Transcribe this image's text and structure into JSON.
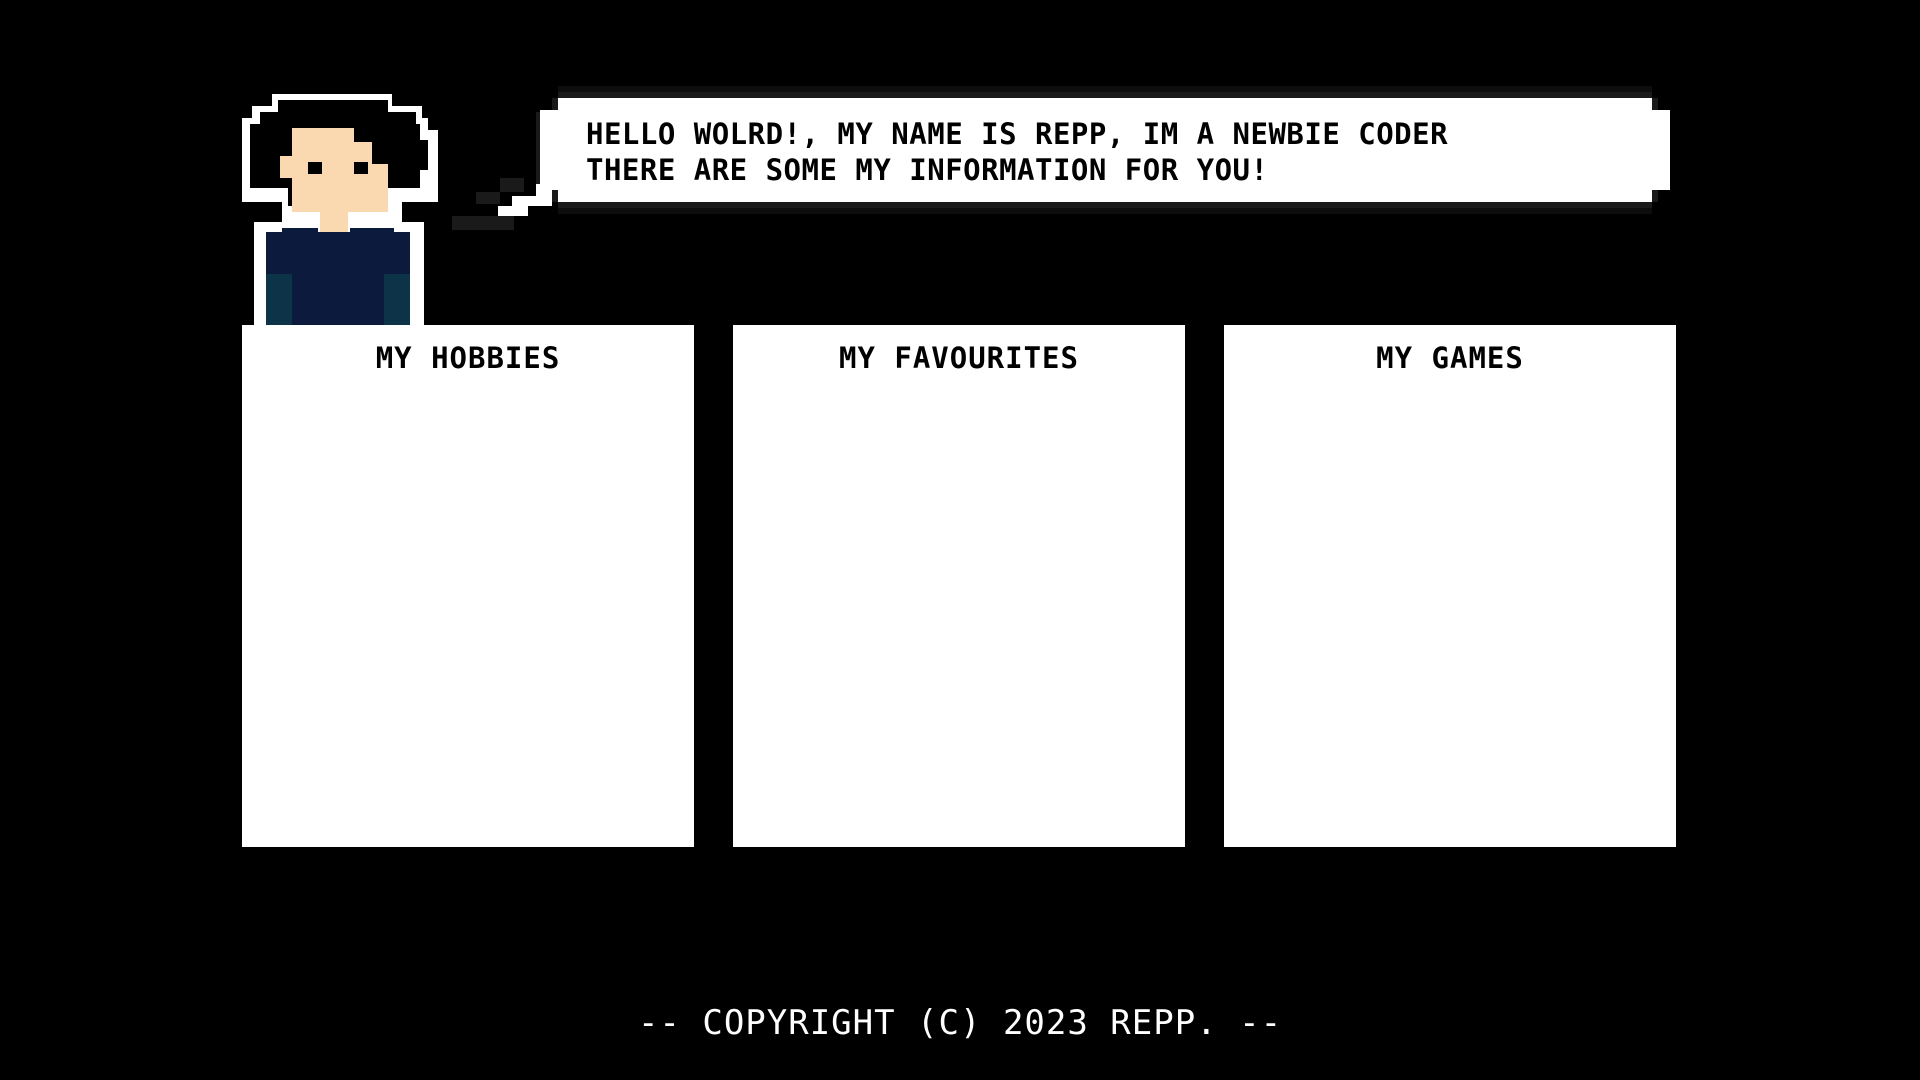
{
  "speech": {
    "line1": "HELLO WOLRD!, MY NAME IS REPP, IM A NEWBIE CODER",
    "line2": "THERE ARE SOME MY INFORMATION FOR YOU!"
  },
  "panels": [
    {
      "title": "MY HOBBIES"
    },
    {
      "title": "MY FAVOURITES"
    },
    {
      "title": "MY GAMES"
    }
  ],
  "footer": {
    "copyright": "-- COPYRIGHT (C) 2023 REPP. --"
  },
  "colors": {
    "background": "#000000",
    "panel": "#ffffff",
    "skin": "#fad8b0",
    "hair": "#000000",
    "jacket": "#0c1a3e",
    "jacket_shade": "#0c3347"
  }
}
